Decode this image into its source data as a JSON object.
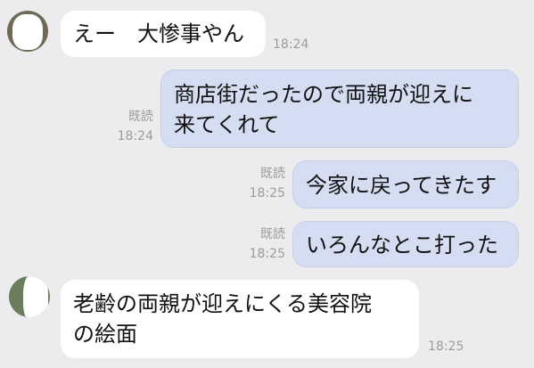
{
  "colors": {
    "background": "#ececef",
    "incoming_bubble": "#ffffff",
    "outgoing_bubble": "#d4ddf1",
    "meta_text": "#9b9b9b"
  },
  "messages": [
    {
      "direction": "incoming",
      "lines": [
        "えー　大惨事やん"
      ],
      "time": "18:24",
      "read": ""
    },
    {
      "direction": "outgoing",
      "lines": [
        "商店街だったので両親が迎えに",
        "来てくれて"
      ],
      "time": "18:24",
      "read": "既読"
    },
    {
      "direction": "outgoing",
      "lines": [
        "今家に戻ってきたす"
      ],
      "time": "18:25",
      "read": "既読"
    },
    {
      "direction": "outgoing",
      "lines": [
        "いろんなとこ打った"
      ],
      "time": "18:25",
      "read": "既読"
    },
    {
      "direction": "incoming",
      "lines": [
        "老齢の両親が迎えにくる美容院",
        "の絵面"
      ],
      "time": "18:25",
      "read": ""
    }
  ]
}
